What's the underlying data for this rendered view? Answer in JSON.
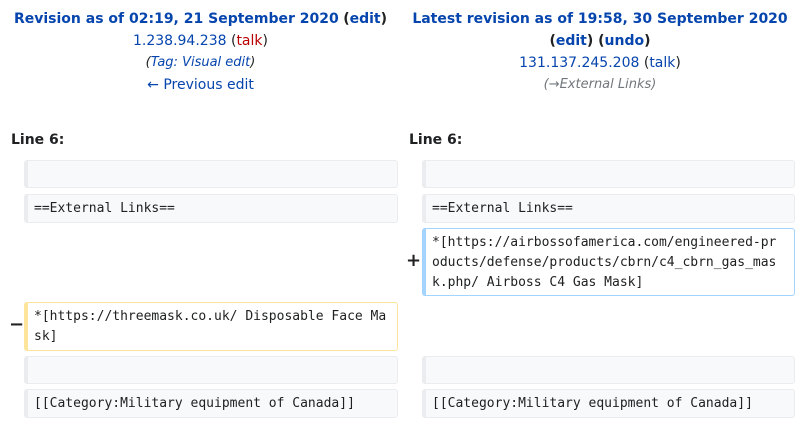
{
  "left": {
    "title": "Revision as of 02:19, 21 September 2020",
    "edit_label": "edit",
    "user": "1.238.94.238",
    "talk_label": "talk",
    "tag_prefix": "Tag: ",
    "tag": "Visual edit",
    "prev_label": "← Previous edit",
    "line_label": "Line 6:"
  },
  "right": {
    "title": "Latest revision as of 19:58, 30 September 2020",
    "edit_label": "edit",
    "undo_label": "undo",
    "user": "131.137.245.208",
    "talk_label": "talk",
    "summary_arrow": "→",
    "summary": "External Links",
    "line_label": "Line 6:"
  },
  "diff": {
    "context_heading": "==External Links==",
    "added_line": "*[https://airbossofamerica.com/engineered-products/defense/products/cbrn/c4_cbrn_gas_mask.php/ Airboss C4 Gas Mask]",
    "removed_line": "*[https://threemask.co.uk/ Disposable Face Mask]",
    "context_category": "[[Category:Military equipment of Canada]]",
    "add_marker": "+",
    "del_marker": "−"
  }
}
